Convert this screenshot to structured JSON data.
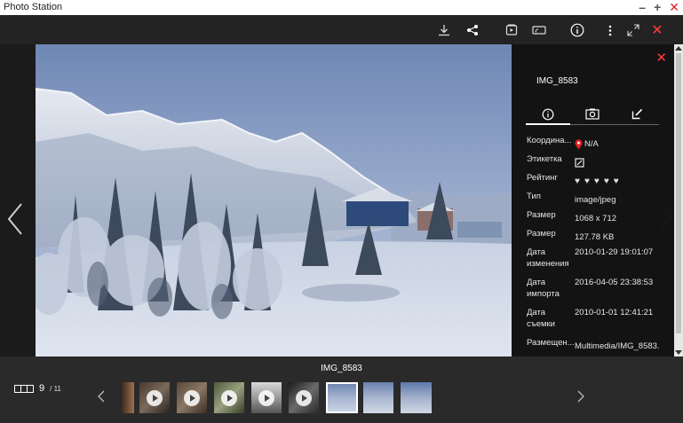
{
  "window": {
    "title": "Photo Station"
  },
  "toolbar": {
    "icons": [
      "download-icon",
      "share-icon",
      "slideshow-icon",
      "cast-icon",
      "info-icon",
      "more-icon",
      "fullscreen-icon",
      "close-icon"
    ]
  },
  "photo": {
    "name": "IMG_8583"
  },
  "info_panel": {
    "title": "IMG_8583",
    "tabs": [
      "info-tab",
      "camera-tab",
      "edit-tab"
    ],
    "rows": [
      {
        "label": "Координа...",
        "value": "N/A"
      },
      {
        "label": "Этикетка",
        "value": ""
      },
      {
        "label": "Рейтинг",
        "value": ""
      },
      {
        "label": "Тип",
        "value": "image/jpeg"
      },
      {
        "label": "Размер",
        "value": "1068 x 712"
      },
      {
        "label": "Размер",
        "value": "127.78 KB"
      },
      {
        "label": "Дата изменения",
        "value": "2010-01-29 19:01:07"
      },
      {
        "label": "Дата импорта",
        "value": "2016-04-05 23:38:53"
      },
      {
        "label": "Дата съемки",
        "value": "2010-01-01 12:41:21"
      },
      {
        "label": "Размещен...",
        "value": "Multimedia/IMG_8583."
      }
    ],
    "rating": 0
  },
  "filmstrip": {
    "title": "IMG_8583",
    "current": "9",
    "total": "/ 11"
  },
  "colors": {
    "accent_close": "#ff3b3b",
    "pin": "#e02020"
  }
}
